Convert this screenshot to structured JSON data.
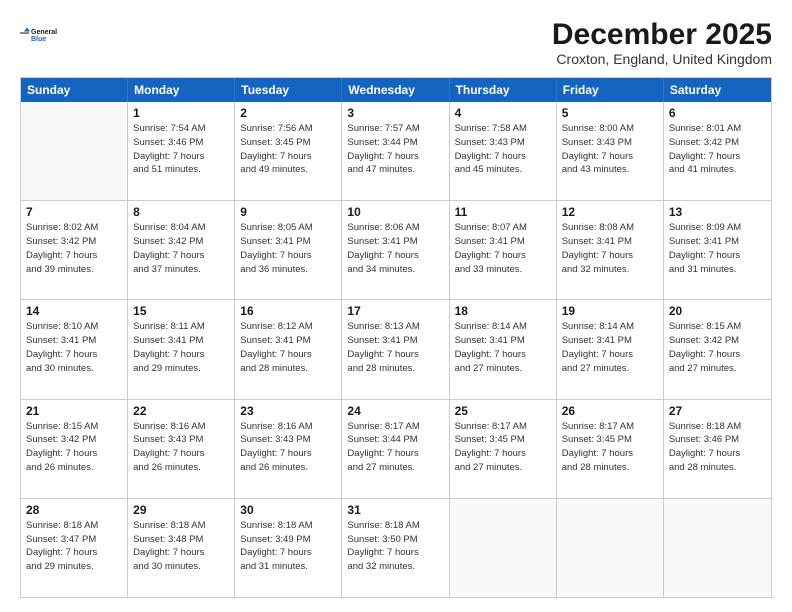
{
  "logo": {
    "general": "General",
    "blue": "Blue"
  },
  "title": "December 2025",
  "subtitle": "Croxton, England, United Kingdom",
  "weekdays": [
    "Sunday",
    "Monday",
    "Tuesday",
    "Wednesday",
    "Thursday",
    "Friday",
    "Saturday"
  ],
  "weeks": [
    [
      {
        "day": "",
        "info": ""
      },
      {
        "day": "1",
        "info": "Sunrise: 7:54 AM\nSunset: 3:46 PM\nDaylight: 7 hours\nand 51 minutes."
      },
      {
        "day": "2",
        "info": "Sunrise: 7:56 AM\nSunset: 3:45 PM\nDaylight: 7 hours\nand 49 minutes."
      },
      {
        "day": "3",
        "info": "Sunrise: 7:57 AM\nSunset: 3:44 PM\nDaylight: 7 hours\nand 47 minutes."
      },
      {
        "day": "4",
        "info": "Sunrise: 7:58 AM\nSunset: 3:43 PM\nDaylight: 7 hours\nand 45 minutes."
      },
      {
        "day": "5",
        "info": "Sunrise: 8:00 AM\nSunset: 3:43 PM\nDaylight: 7 hours\nand 43 minutes."
      },
      {
        "day": "6",
        "info": "Sunrise: 8:01 AM\nSunset: 3:42 PM\nDaylight: 7 hours\nand 41 minutes."
      }
    ],
    [
      {
        "day": "7",
        "info": "Sunrise: 8:02 AM\nSunset: 3:42 PM\nDaylight: 7 hours\nand 39 minutes."
      },
      {
        "day": "8",
        "info": "Sunrise: 8:04 AM\nSunset: 3:42 PM\nDaylight: 7 hours\nand 37 minutes."
      },
      {
        "day": "9",
        "info": "Sunrise: 8:05 AM\nSunset: 3:41 PM\nDaylight: 7 hours\nand 36 minutes."
      },
      {
        "day": "10",
        "info": "Sunrise: 8:06 AM\nSunset: 3:41 PM\nDaylight: 7 hours\nand 34 minutes."
      },
      {
        "day": "11",
        "info": "Sunrise: 8:07 AM\nSunset: 3:41 PM\nDaylight: 7 hours\nand 33 minutes."
      },
      {
        "day": "12",
        "info": "Sunrise: 8:08 AM\nSunset: 3:41 PM\nDaylight: 7 hours\nand 32 minutes."
      },
      {
        "day": "13",
        "info": "Sunrise: 8:09 AM\nSunset: 3:41 PM\nDaylight: 7 hours\nand 31 minutes."
      }
    ],
    [
      {
        "day": "14",
        "info": "Sunrise: 8:10 AM\nSunset: 3:41 PM\nDaylight: 7 hours\nand 30 minutes."
      },
      {
        "day": "15",
        "info": "Sunrise: 8:11 AM\nSunset: 3:41 PM\nDaylight: 7 hours\nand 29 minutes."
      },
      {
        "day": "16",
        "info": "Sunrise: 8:12 AM\nSunset: 3:41 PM\nDaylight: 7 hours\nand 28 minutes."
      },
      {
        "day": "17",
        "info": "Sunrise: 8:13 AM\nSunset: 3:41 PM\nDaylight: 7 hours\nand 28 minutes."
      },
      {
        "day": "18",
        "info": "Sunrise: 8:14 AM\nSunset: 3:41 PM\nDaylight: 7 hours\nand 27 minutes."
      },
      {
        "day": "19",
        "info": "Sunrise: 8:14 AM\nSunset: 3:41 PM\nDaylight: 7 hours\nand 27 minutes."
      },
      {
        "day": "20",
        "info": "Sunrise: 8:15 AM\nSunset: 3:42 PM\nDaylight: 7 hours\nand 27 minutes."
      }
    ],
    [
      {
        "day": "21",
        "info": "Sunrise: 8:15 AM\nSunset: 3:42 PM\nDaylight: 7 hours\nand 26 minutes."
      },
      {
        "day": "22",
        "info": "Sunrise: 8:16 AM\nSunset: 3:43 PM\nDaylight: 7 hours\nand 26 minutes."
      },
      {
        "day": "23",
        "info": "Sunrise: 8:16 AM\nSunset: 3:43 PM\nDaylight: 7 hours\nand 26 minutes."
      },
      {
        "day": "24",
        "info": "Sunrise: 8:17 AM\nSunset: 3:44 PM\nDaylight: 7 hours\nand 27 minutes."
      },
      {
        "day": "25",
        "info": "Sunrise: 8:17 AM\nSunset: 3:45 PM\nDaylight: 7 hours\nand 27 minutes."
      },
      {
        "day": "26",
        "info": "Sunrise: 8:17 AM\nSunset: 3:45 PM\nDaylight: 7 hours\nand 28 minutes."
      },
      {
        "day": "27",
        "info": "Sunrise: 8:18 AM\nSunset: 3:46 PM\nDaylight: 7 hours\nand 28 minutes."
      }
    ],
    [
      {
        "day": "28",
        "info": "Sunrise: 8:18 AM\nSunset: 3:47 PM\nDaylight: 7 hours\nand 29 minutes."
      },
      {
        "day": "29",
        "info": "Sunrise: 8:18 AM\nSunset: 3:48 PM\nDaylight: 7 hours\nand 30 minutes."
      },
      {
        "day": "30",
        "info": "Sunrise: 8:18 AM\nSunset: 3:49 PM\nDaylight: 7 hours\nand 31 minutes."
      },
      {
        "day": "31",
        "info": "Sunrise: 8:18 AM\nSunset: 3:50 PM\nDaylight: 7 hours\nand 32 minutes."
      },
      {
        "day": "",
        "info": ""
      },
      {
        "day": "",
        "info": ""
      },
      {
        "day": "",
        "info": ""
      }
    ]
  ]
}
